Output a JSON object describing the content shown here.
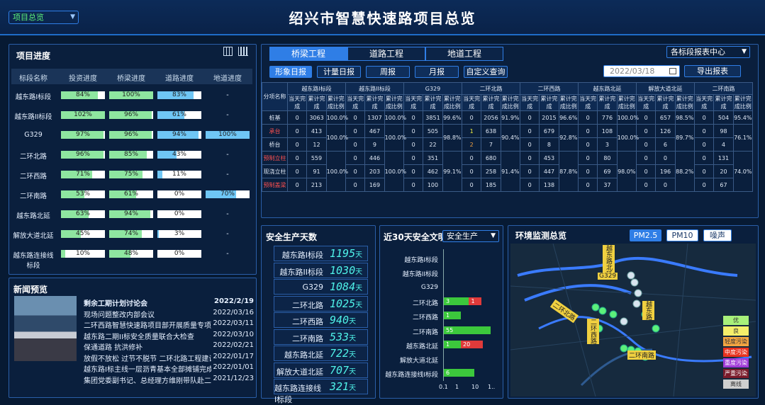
{
  "header": {
    "title": "绍兴市智慧快速路项目总览",
    "project_select": "项目总览"
  },
  "progress": {
    "title": "项目进度",
    "columns": [
      "标段名称",
      "投资进度",
      "桥梁进度",
      "道路进度",
      "地道进度"
    ],
    "rows": [
      {
        "name": "越东路I标段",
        "inv": "84%",
        "inv_v": 0.84,
        "bri": "100%",
        "bri_v": 1.0,
        "road": "83%",
        "road_v": 0.83,
        "tun": "-"
      },
      {
        "name": "越东路II标段",
        "inv": "102%",
        "inv_v": 1.0,
        "bri": "96%",
        "bri_v": 0.96,
        "road": "61%",
        "road_v": 0.61,
        "tun": "-"
      },
      {
        "name": "G329",
        "inv": "97%",
        "inv_v": 0.97,
        "bri": "96%",
        "bri_v": 0.96,
        "road": "94%",
        "road_v": 0.94,
        "tun": "100%",
        "tun_v": 1.0
      },
      {
        "name": "二环北路",
        "inv": "96%",
        "inv_v": 0.96,
        "bri": "85%",
        "bri_v": 0.85,
        "road": "43%",
        "road_v": 0.43,
        "tun": "-"
      },
      {
        "name": "二环西路",
        "inv": "71%",
        "inv_v": 0.71,
        "bri": "75%",
        "bri_v": 0.75,
        "road": "11%",
        "road_v": 0.11,
        "tun": "-"
      },
      {
        "name": "二环南路",
        "inv": "53%",
        "inv_v": 0.53,
        "bri": "61%",
        "bri_v": 0.61,
        "road": "0%",
        "road_v": 0,
        "tun": "70%",
        "tun_v": 0.7
      },
      {
        "name": "越东路北延",
        "inv": "63%",
        "inv_v": 0.63,
        "bri": "94%",
        "bri_v": 0.94,
        "road": "0%",
        "road_v": 0,
        "tun": "-"
      },
      {
        "name": "解放大道北延",
        "inv": "45%",
        "inv_v": 0.45,
        "bri": "74%",
        "bri_v": 0.74,
        "road": "3%",
        "road_v": 0.03,
        "tun": "-"
      },
      {
        "name": "越东路连接线标段",
        "inv": "10%",
        "inv_v": 0.1,
        "bri": "48%",
        "bri_v": 0.48,
        "road": "0%",
        "road_v": 0,
        "tun": "-"
      }
    ]
  },
  "news": {
    "title": "新闻预览",
    "items": [
      {
        "t": "剩余工期计划讨论会",
        "d": "2022/2/19"
      },
      {
        "t": "现场问题整改内部会议",
        "d": "2022/03/16"
      },
      {
        "t": "二环西路智慧快速路项目部开展质量专项检查",
        "d": "2022/03/11"
      },
      {
        "t": "越东路二期II标安全质量联合大检查",
        "d": "2022/03/10"
      },
      {
        "t": "保通道路 抗洪修补",
        "d": "2022/02/21"
      },
      {
        "t": "放假不放松 过节不脱节 二环北路工程建设",
        "d": "2022/01/17"
      },
      {
        "t": "越东路I标主线一层沥青基本全部摊铺完成",
        "d": "2022/01/01"
      },
      {
        "t": "集团党委副书记、总经理方维刚带队赴二环",
        "d": "2021/12/23"
      }
    ]
  },
  "report": {
    "tabs": [
      "桥梁工程",
      "道路工程",
      "地道工程"
    ],
    "report_select": "各标段报表中心",
    "buttons": [
      "形象日报",
      "计量日报",
      "周报",
      "月报",
      "自定义查询"
    ],
    "date": "2022/03/18",
    "export": "导出报表",
    "sections": [
      "越东路I标段",
      "越东路II标段",
      "G329",
      "二环北路",
      "二环西路",
      "越东路北延",
      "解放大道北延",
      "二环南路"
    ],
    "sub": [
      "当天完成",
      "累计完成",
      "累计完成比例"
    ],
    "item_col": "分项名称",
    "items": [
      "桩基",
      "承台",
      "桥台",
      "预制立柱",
      "现浇立柱",
      "预制盖梁"
    ],
    "cells": [
      [
        "0",
        "3063",
        "100.0%",
        "0",
        "1307",
        "100.0%",
        "0",
        "3851",
        "99.6%",
        "0",
        "2056",
        "91.9%",
        "0",
        "2015",
        "96.6%",
        "0",
        "776",
        "100.0%",
        "0",
        "657",
        "98.5%",
        "0",
        "504",
        "95.4%"
      ],
      [
        "0",
        "413",
        "",
        "0",
        "467",
        "",
        "0",
        "505",
        "",
        "1",
        "638",
        "",
        "0",
        "679",
        "",
        "0",
        "108",
        "",
        "0",
        "126",
        "",
        "0",
        "98",
        ""
      ],
      [
        "0",
        "12",
        "",
        "0",
        "9",
        "",
        "0",
        "22",
        "",
        "2",
        "7",
        "",
        "0",
        "8",
        "",
        "0",
        "3",
        "",
        "0",
        "6",
        "",
        "0",
        "4",
        ""
      ],
      [
        "0",
        "559",
        "",
        "0",
        "446",
        "",
        "0",
        "351",
        "",
        "0",
        "680",
        "",
        "0",
        "453",
        "",
        "0",
        "80",
        "",
        "0",
        "0",
        "",
        "0",
        "131",
        ""
      ],
      [
        "0",
        "91",
        "",
        "0",
        "203",
        "",
        "0",
        "462",
        "",
        "0",
        "258",
        "",
        "0",
        "447",
        "",
        "0",
        "69",
        "",
        "0",
        "196",
        "",
        "0",
        "20",
        ""
      ],
      [
        "0",
        "213",
        "",
        "0",
        "169",
        "",
        "0",
        "100",
        "",
        "0",
        "185",
        "",
        "0",
        "138",
        "",
        "0",
        "37",
        "",
        "0",
        "0",
        "",
        "0",
        "67",
        ""
      ]
    ],
    "merged": [
      "100.0%",
      "100.0%",
      "98.8%",
      "90.4%",
      "92.8%",
      "100.0%",
      "89.7%",
      "76.1%"
    ],
    "merged2": [
      "100.0%",
      "100.0%",
      "99.1%",
      "91.4%",
      "87.8%",
      "98.0%",
      "88.2%",
      "74.0%"
    ]
  },
  "safety": {
    "title": "安全生产天数",
    "unit": "天",
    "rows": [
      {
        "l": "越东路I标段",
        "v": "1195"
      },
      {
        "l": "越东路II标段",
        "v": "1030"
      },
      {
        "l": "G329",
        "v": "1084"
      },
      {
        "l": "二环北路",
        "v": "1025"
      },
      {
        "l": "二环西路",
        "v": "940"
      },
      {
        "l": "二环南路",
        "v": "533"
      },
      {
        "l": "越东路北延",
        "v": "722"
      },
      {
        "l": "解放大道北延",
        "v": "707"
      },
      {
        "l": "越东路连接线I标段",
        "v": "321"
      }
    ]
  },
  "civ": {
    "title": "近30天安全文明",
    "select": "安全生产"
  },
  "chart_data": {
    "type": "bar",
    "categories": [
      "越东路I标段",
      "越东路II标段",
      "G329",
      "二环北路",
      "二环西路",
      "二环南路",
      "越东路北延",
      "解放大道北延",
      "越东路连接线I标段"
    ],
    "series": [
      {
        "values": [
          0,
          0,
          0,
          3,
          1,
          55,
          1,
          0,
          6
        ],
        "color": "#3cc83c"
      },
      {
        "values": [
          0,
          0,
          0,
          1,
          0,
          0,
          20,
          0,
          0
        ],
        "color": "#e03a3a"
      }
    ],
    "xscale": "log",
    "xticks": [
      "0.1",
      "1",
      "10",
      "1.."
    ]
  },
  "env": {
    "title": "环境监测总览",
    "tabs": [
      "PM2.5",
      "PM10",
      "噪声"
    ],
    "legend": [
      {
        "l": "优",
        "c": "#a8f07a"
      },
      {
        "l": "良",
        "c": "#f5ee6a"
      },
      {
        "l": "轻度污染",
        "c": "#f5a742"
      },
      {
        "l": "中度污染",
        "c": "#e8321e"
      },
      {
        "l": "重度污染",
        "c": "#a03ad8"
      },
      {
        "l": "严重污染",
        "c": "#7a1a2a"
      },
      {
        "l": "离线",
        "c": "#cfcfcf"
      }
    ],
    "labels": [
      "越东路北延",
      "G329",
      "二环北路",
      "越东路",
      "二环西路",
      "二环南路"
    ]
  }
}
